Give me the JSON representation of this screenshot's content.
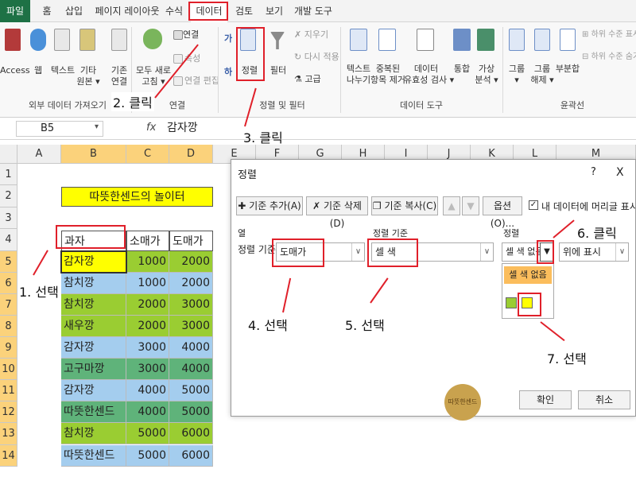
{
  "menu": {
    "tabs": [
      "파일",
      "홈",
      "삽입",
      "페이지 레이아웃",
      "수식",
      "데이터",
      "검토",
      "보기",
      "개발 도구"
    ]
  },
  "ribbon": {
    "external_group": {
      "items": [
        {
          "label": "Access",
          "icon": "access-icon"
        },
        {
          "label": "웹",
          "icon": "web-icon"
        },
        {
          "label": "텍스트",
          "icon": "text-file-icon"
        },
        {
          "label": "기타\n원본 ▾",
          "icon": "other-sources-icon"
        },
        {
          "label": "기존\n연결",
          "icon": "existing-connection-icon"
        }
      ],
      "label": "외부 데이터 가져오기"
    },
    "connection_group": {
      "refresh_label": "모두 새로\n고침 ▾",
      "connect_label": "연결",
      "properties_label": "속성",
      "edit_links_label": "연결 편집",
      "label": "연결"
    },
    "sort_group": {
      "sort_label": "정렬",
      "filter_label": "필터",
      "clear_label": "지우기",
      "reapply_label": "다시 적용",
      "advanced_label": "고급",
      "label": "정렬 및 필터"
    },
    "tools_group": {
      "items": [
        {
          "label": "텍스트\n나누기"
        },
        {
          "label": "중복된\n항목 제거"
        },
        {
          "label": "데이터\n유효성 검사 ▾"
        },
        {
          "label": "통합"
        },
        {
          "label": "가상\n분석 ▾"
        }
      ],
      "label": "데이터 도구"
    },
    "outline_group": {
      "items": [
        {
          "label": "그룹\n▾"
        },
        {
          "label": "그룹\n해제 ▾"
        },
        {
          "label": "부분합"
        }
      ],
      "show_detail": "하위 수준 표시",
      "hide_detail": "하위 수준 숨기",
      "label": "윤곽선"
    }
  },
  "formula_bar": {
    "name_box": "B5",
    "fx": "fx",
    "value": "감자깡"
  },
  "sheet": {
    "columns": [
      "A",
      "B",
      "C",
      "D",
      "E",
      "F",
      "G",
      "H",
      "I",
      "J",
      "K",
      "L",
      "M"
    ],
    "rows": [
      "1",
      "2",
      "3",
      "4",
      "5",
      "6",
      "7",
      "8",
      "9",
      "10",
      "11",
      "12",
      "13",
      "14"
    ],
    "title": "따뜻한센드의 놀이터",
    "headers": [
      "과자",
      "소매가",
      "도매가"
    ],
    "data": [
      {
        "name": "감자깡",
        "retail": "1000",
        "wholesale": "2000",
        "name_color": "#ffff00",
        "num_color": "#9acd32"
      },
      {
        "name": "참치깡",
        "retail": "1000",
        "wholesale": "2000",
        "name_color": "#a4cdee",
        "num_color": "#a4cdee"
      },
      {
        "name": "참치깡",
        "retail": "2000",
        "wholesale": "3000",
        "name_color": "#9acd32",
        "num_color": "#9acd32"
      },
      {
        "name": "새우깡",
        "retail": "2000",
        "wholesale": "3000",
        "name_color": "#9acd32",
        "num_color": "#9acd32"
      },
      {
        "name": "감자깡",
        "retail": "3000",
        "wholesale": "4000",
        "name_color": "#a4cdee",
        "num_color": "#a4cdee"
      },
      {
        "name": "고구마깡",
        "retail": "3000",
        "wholesale": "4000",
        "name_color": "#5fb37a",
        "num_color": "#5fb37a"
      },
      {
        "name": "감자깡",
        "retail": "4000",
        "wholesale": "5000",
        "name_color": "#a4cdee",
        "num_color": "#a4cdee"
      },
      {
        "name": "따뜻한센드",
        "retail": "4000",
        "wholesale": "5000",
        "name_color": "#5fb37a",
        "num_color": "#5fb37a"
      },
      {
        "name": "참치깡",
        "retail": "5000",
        "wholesale": "6000",
        "name_color": "#9acd32",
        "num_color": "#9acd32"
      },
      {
        "name": "따뜻한센드",
        "retail": "5000",
        "wholesale": "6000",
        "name_color": "#a4cdee",
        "num_color": "#a4cdee"
      }
    ]
  },
  "dialog": {
    "title": "정렬",
    "help": "?",
    "close": "X",
    "add_level": "기준 추가(A)",
    "delete_level": "기준 삭제(D)",
    "copy_level": "기준 복사(C)",
    "options": "옵션(O)...",
    "has_headers": "내 데이터에 머리글 표시(H)",
    "col_header": "열",
    "sort_on_header": "정렬 기준",
    "order_header": "정렬",
    "row_label": "정렬 기준",
    "column_value": "도매가",
    "sort_on_value": "셀 색",
    "order_value": "셀 색 없음",
    "position_value": "위에 표시",
    "dropdown_first": "셀 색 없음",
    "colors": [
      "#9acd32",
      "#ffff00"
    ],
    "ok": "확인",
    "cancel": "취소",
    "stamp": "따뜻한센드"
  },
  "annotations": {
    "a1": "1. 선택",
    "a2": "2. 클릭",
    "a3": "3. 클릭",
    "a4": "4. 선택",
    "a5": "5. 선택",
    "a6": "6. 클릭",
    "a7": "7. 선택"
  }
}
